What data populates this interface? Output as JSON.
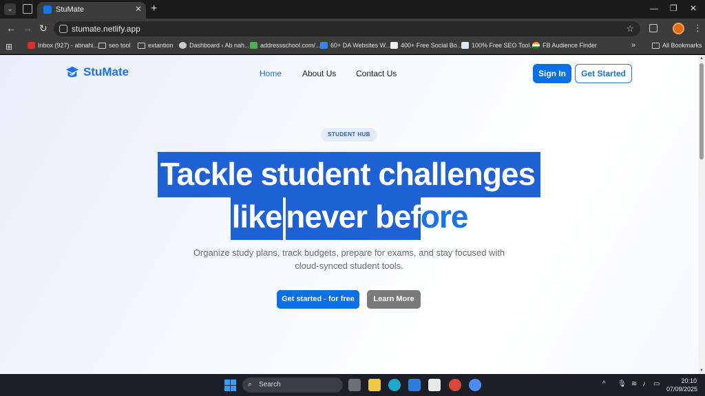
{
  "browser": {
    "tab_title": "StuMate",
    "url": "stumate.netlify.app",
    "bookmarks": [
      {
        "label": "Inbox (927) - abnahi..."
      },
      {
        "label": "seo tool"
      },
      {
        "label": "extantion"
      },
      {
        "label": "Dashboard ‹ Ab nah..."
      },
      {
        "label": "addressschool.com/..."
      },
      {
        "label": "60+ DA Websites W..."
      },
      {
        "label": "400+ Free Social Bo..."
      },
      {
        "label": "100% Free SEO Tool..."
      },
      {
        "label": "FB Audience Finder"
      }
    ],
    "all_bookmarks": "All Bookmarks"
  },
  "site": {
    "brand": "StuMate",
    "nav": {
      "home": "Home",
      "about": "About Us",
      "contact": "Contact Us"
    },
    "sign_in": "Sign In",
    "get_started": "Get Started",
    "badge": "STUDENT HUB",
    "hero": {
      "line1": "Tackle student challenges",
      "line2_a": "like",
      "line2_b": "never bef",
      "line2_c": "ore"
    },
    "subtitle_1": "Organize study plans, track budgets, prepare for exams, and stay focused with",
    "subtitle_2": "cloud-synced student tools.",
    "cta_primary": "Get started - for free",
    "cta_secondary": "Learn More",
    "accent_color": "#1a73e8",
    "highlight_color": "#1d61d4"
  },
  "taskbar": {
    "search_placeholder": "Search",
    "time": "20:10",
    "date": "07/09/2025"
  }
}
